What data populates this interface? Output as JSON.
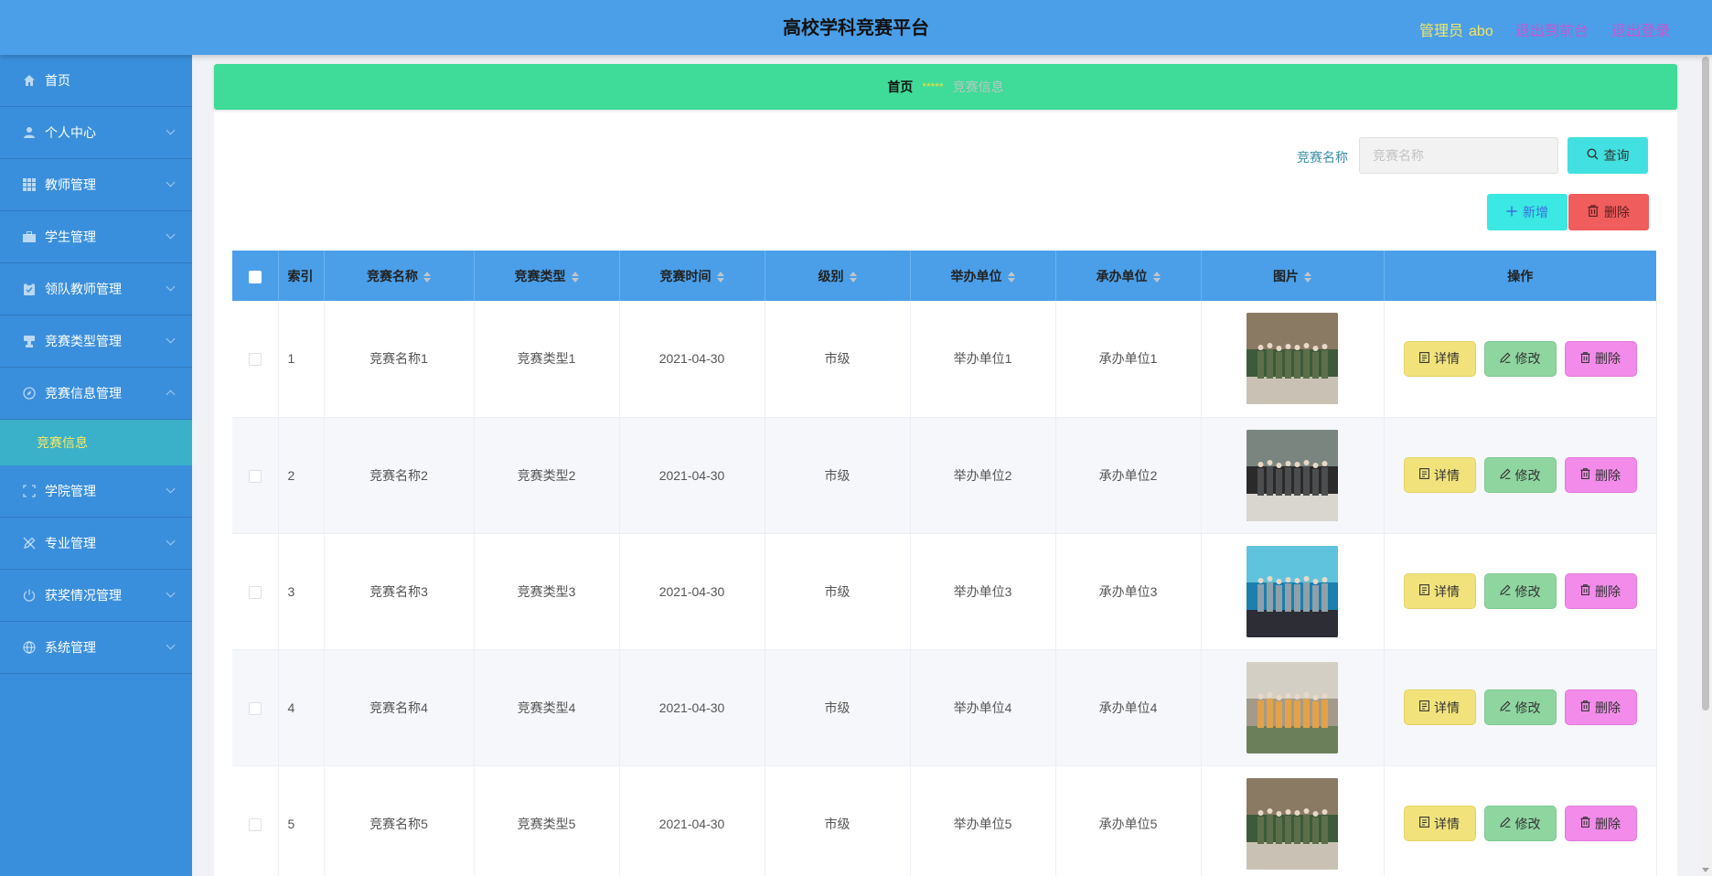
{
  "header": {
    "title": "高校学科竞赛平台",
    "role": "管理员",
    "username": "abo",
    "to_front": "退出到前台",
    "logout": "退出登录"
  },
  "sidebar": {
    "items": [
      {
        "label": "首页",
        "icon": "home-icon"
      },
      {
        "label": "个人中心",
        "icon": "user-icon"
      },
      {
        "label": "教师管理",
        "icon": "grid-icon"
      },
      {
        "label": "学生管理",
        "icon": "briefcase-icon"
      },
      {
        "label": "领队教师管理",
        "icon": "clipboard-icon"
      },
      {
        "label": "竞赛类型管理",
        "icon": "stamp-icon"
      },
      {
        "label": "竞赛信息管理",
        "icon": "compass-icon"
      },
      {
        "label": "学院管理",
        "icon": "frame-icon"
      },
      {
        "label": "专业管理",
        "icon": "edit-off-icon"
      },
      {
        "label": "获奖情况管理",
        "icon": "power-icon"
      },
      {
        "label": "系统管理",
        "icon": "globe-icon"
      }
    ],
    "active_sub": "竞赛信息"
  },
  "breadcrumb": {
    "home": "首页",
    "separator": "*****",
    "current": "竞赛信息"
  },
  "search": {
    "label": "竞赛名称",
    "placeholder": "竞赛名称",
    "value": "",
    "query_button": "查询"
  },
  "actions": {
    "add": "新增",
    "delete": "删除"
  },
  "table": {
    "columns": [
      "索引",
      "竞赛名称",
      "竞赛类型",
      "竞赛时间",
      "级别",
      "举办单位",
      "承办单位",
      "图片",
      "操作"
    ],
    "ops": {
      "detail": "详情",
      "edit": "修改",
      "delete": "删除"
    },
    "rows": [
      {
        "index": "1",
        "name": "竞赛名称1",
        "type": "竞赛类型1",
        "time": "2021-04-30",
        "level": "市级",
        "host": "举办单位1",
        "organizer": "承办单位1"
      },
      {
        "index": "2",
        "name": "竞赛名称2",
        "type": "竞赛类型2",
        "time": "2021-04-30",
        "level": "市级",
        "host": "举办单位2",
        "organizer": "承办单位2"
      },
      {
        "index": "3",
        "name": "竞赛名称3",
        "type": "竞赛类型3",
        "time": "2021-04-30",
        "level": "市级",
        "host": "举办单位3",
        "organizer": "承办单位3"
      },
      {
        "index": "4",
        "name": "竞赛名称4",
        "type": "竞赛类型4",
        "time": "2021-04-30",
        "level": "市级",
        "host": "举办单位4",
        "organizer": "承办单位4"
      },
      {
        "index": "5",
        "name": "竞赛名称5",
        "type": "竞赛类型5",
        "time": "2021-04-30",
        "level": "市级",
        "host": "举办单位5",
        "organizer": "承办单位5"
      }
    ]
  },
  "colors": {
    "header": "#4a9fe8",
    "sidebar": "#3a8fdc",
    "breadcrumb": "#3fdb98",
    "detail_button": "#f1e27b",
    "edit_button": "#8fd5a0",
    "delete_button": "#f28be9"
  }
}
